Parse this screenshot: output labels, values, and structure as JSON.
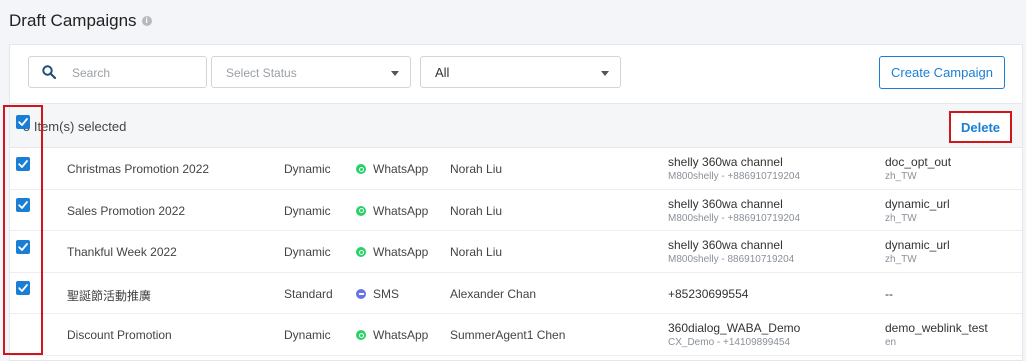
{
  "page": {
    "title": "Draft Campaigns",
    "info_icon": "info-icon"
  },
  "toolbar": {
    "search_placeholder": "Search",
    "status_placeholder": "Select Status",
    "filter_value": "All",
    "create_label": "Create Campaign"
  },
  "selection": {
    "text": "5 Item(s) selected",
    "delete_label": "Delete"
  },
  "colors": {
    "accent": "#1a7fd4",
    "highlight_border": "#d0151c",
    "whatsapp": "#25d366",
    "sms": "#6573e8"
  },
  "rows": [
    {
      "checked": true,
      "name": "Christmas Promotion 2022",
      "type": "Dynamic",
      "channel": "WhatsApp",
      "channel_icon": "whatsapp-icon",
      "owner": "Norah Liu",
      "from": "shelly 360wa channel",
      "from_sub": "M800shelly - +886910719204",
      "template": "doc_opt_out",
      "template_sub": "zh_TW"
    },
    {
      "checked": true,
      "name": "Sales Promotion 2022",
      "type": "Dynamic",
      "channel": "WhatsApp",
      "channel_icon": "whatsapp-icon",
      "owner": "Norah Liu",
      "from": "shelly 360wa channel",
      "from_sub": "M800shelly - +886910719204",
      "template": "dynamic_url",
      "template_sub": "zh_TW"
    },
    {
      "checked": true,
      "name": "Thankful Week 2022",
      "type": "Dynamic",
      "channel": "WhatsApp",
      "channel_icon": "whatsapp-icon",
      "owner": "Norah Liu",
      "from": "shelly 360wa channel",
      "from_sub": "M800shelly - 886910719204",
      "template": "dynamic_url",
      "template_sub": "zh_TW"
    },
    {
      "checked": true,
      "name": "聖誕節活動推廣",
      "type": "Standard",
      "channel": "SMS",
      "channel_icon": "sms-icon",
      "owner": "Alexander Chan",
      "from": "+85230699554",
      "from_sub": "",
      "template": "--",
      "template_sub": ""
    },
    {
      "checked": true,
      "name": "Discount Promotion",
      "type": "Dynamic",
      "channel": "WhatsApp",
      "channel_icon": "whatsapp-icon",
      "owner": "SummerAgent1 Chen",
      "from": "360dialog_WABA_Demo",
      "from_sub": "CX_Demo - +14109899454",
      "template": "demo_weblink_test",
      "template_sub": "en"
    }
  ]
}
